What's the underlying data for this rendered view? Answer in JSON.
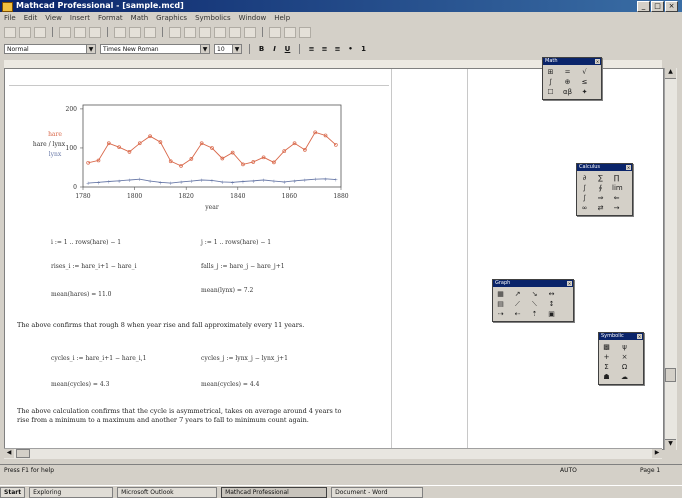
{
  "window": {
    "title": "Mathcad Professional - [sample.mcd]",
    "controls": [
      "_",
      "□",
      "×"
    ]
  },
  "menu": [
    "File",
    "Edit",
    "View",
    "Insert",
    "Format",
    "Math",
    "Graphics",
    "Symbolics",
    "Window",
    "Help"
  ],
  "format_bar": {
    "style": "Normal",
    "font": "Times New Roman",
    "size": "10"
  },
  "chart_data": {
    "type": "line",
    "xlim": [
      1780,
      1880
    ],
    "ylim": [
      0,
      210
    ],
    "x_ticks": [
      "1780",
      "1800",
      "1820",
      "1840",
      "1860",
      "1880"
    ],
    "y_ticks": [
      "200",
      "100",
      "0"
    ],
    "xlabel": "year",
    "ylabel": "hare / lynx",
    "series": [
      {
        "name": "hare",
        "color": "#d9684a",
        "x": [
          1782,
          1786,
          1790,
          1794,
          1798,
          1802,
          1806,
          1810,
          1814,
          1818,
          1822,
          1826,
          1830,
          1834,
          1838,
          1842,
          1846,
          1850,
          1854,
          1858,
          1862,
          1866,
          1870,
          1874,
          1878
        ],
        "y": [
          62,
          68,
          112,
          102,
          90,
          112,
          130,
          115,
          66,
          54,
          72,
          112,
          100,
          73,
          88,
          58,
          64,
          76,
          63,
          92,
          112,
          95,
          140,
          132,
          108
        ]
      },
      {
        "name": "lynx",
        "color": "#6a7aa8",
        "x": [
          1782,
          1786,
          1790,
          1794,
          1798,
          1802,
          1806,
          1810,
          1814,
          1818,
          1822,
          1826,
          1830,
          1834,
          1838,
          1842,
          1846,
          1850,
          1854,
          1858,
          1862,
          1866,
          1870,
          1874,
          1878
        ],
        "y": [
          10,
          12,
          14,
          16,
          18,
          20,
          15,
          12,
          10,
          13,
          15,
          18,
          17,
          13,
          12,
          14,
          16,
          18,
          15,
          13,
          16,
          18,
          20,
          21,
          19
        ]
      }
    ]
  },
  "equations": {
    "i_def": "i := 1 .. rows(hare) − 1",
    "j_def": "j := 1 .. rows(hare) − 1",
    "diff_a": "rises_i := hare_i+1 − hare_i",
    "diff_b": "falls_j := hare_j − hare_j+1",
    "mean_a": "mean(hares) = 11.0",
    "mean_b": "mean(lynx) = 7.2",
    "cyc_a": "cycles_i := hare_i+1 − hare_i,1",
    "cyc_b": "cycles_j := lynx_j − lynx_j+1",
    "mean_c": "mean(cycles) = 4.3",
    "mean_d": "mean(cycles) = 4.4"
  },
  "text": {
    "p1": "The above confirms that rough 8 when year rise and fall approximately every 11 years.",
    "p2": "The above calculation confirms that the cycle is asymmetrical, takes on average around 4 years to rise from a minimum to a maximum and another 7 years to fall to minimum count again."
  },
  "status": {
    "left": "Press F1 for help",
    "mid": "AUTO",
    "right": "Page 1"
  },
  "taskbar": [
    "Start",
    "Exploring",
    "Microsoft Outlook",
    "Mathcad Professional",
    "Document - Word"
  ],
  "palettes": {
    "math": {
      "title": "Math",
      "icons": [
        "⊞",
        "=",
        "√",
        "∫",
        "⊕",
        "≤",
        "☐",
        "αβ",
        "✦"
      ]
    },
    "greek": {
      "title": "Calculus",
      "icons": [
        "∂",
        "∑",
        "∏",
        "∫",
        "∮",
        "lim",
        "∫",
        "⇒",
        "⇐",
        "∞",
        "⇄",
        "→"
      ]
    },
    "graph": {
      "title": "Graph",
      "icons": [
        "▦",
        "↗",
        "↘",
        "↔",
        "▤",
        "⟋",
        "⟍",
        "↕",
        "⇢",
        "⇠",
        "⇡",
        "▣"
      ]
    },
    "symbolic": {
      "title": "Symbolic",
      "icons": [
        "▩",
        "ψ",
        "+",
        "×",
        "Σ",
        "Ω",
        "☗",
        "☁"
      ]
    }
  }
}
